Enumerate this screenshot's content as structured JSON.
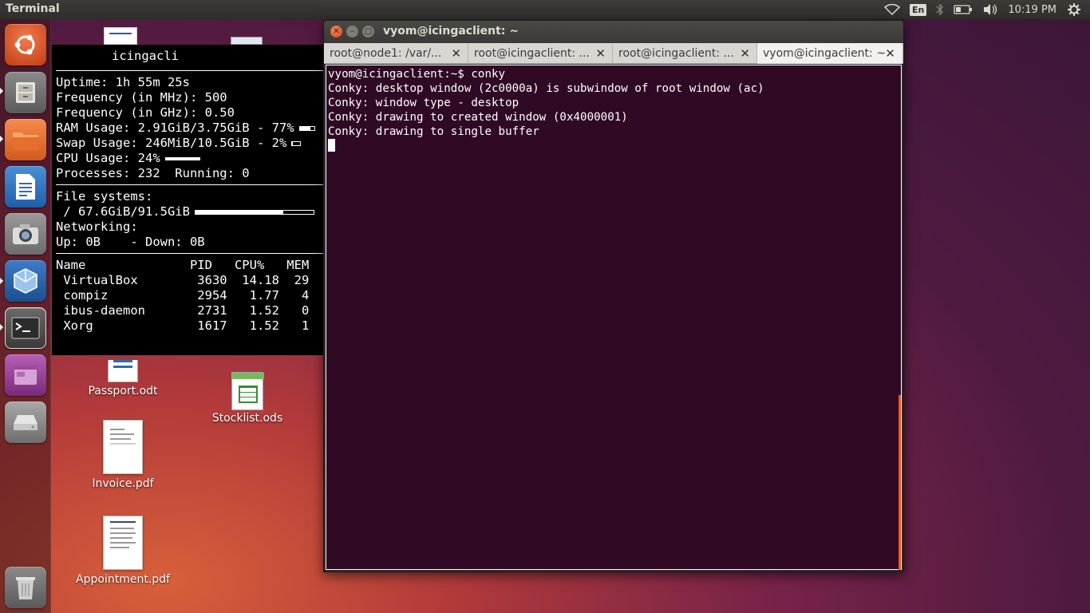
{
  "top_panel": {
    "app_title": "Terminal",
    "keyboard_layout": "En",
    "clock": "10:19 PM"
  },
  "launcher": {
    "items": [
      {
        "name": "Dash"
      },
      {
        "name": "Files"
      },
      {
        "name": "Files Folder"
      },
      {
        "name": "LibreOffice Writer"
      },
      {
        "name": "Shotwell"
      },
      {
        "name": "VirtualBox"
      },
      {
        "name": "Terminal"
      },
      {
        "name": "Workspace Switcher"
      },
      {
        "name": "Disk"
      },
      {
        "name": "Trash"
      }
    ]
  },
  "desktop": {
    "icons": [
      {
        "label": "Passport.odt"
      },
      {
        "label": "Stocklist.ods"
      },
      {
        "label": "Invoice.pdf"
      },
      {
        "label": "Appointment.pdf"
      }
    ]
  },
  "conky": {
    "hostname": "icingacli",
    "uptime": "Uptime: 1h 55m 25s",
    "freq_mhz": "Frequency (in MHz): 500",
    "freq_ghz": "Frequency (in GHz): 0.50",
    "ram": "RAM Usage: 2.91GiB/3.75GiB - 77%",
    "ram_fraction": 0.77,
    "swap": "Swap Usage: 246MiB/10.5GiB - 2%",
    "swap_fraction": 0.02,
    "cpu": "CPU Usage: 24%",
    "cpu_fraction": 0.24,
    "processes": "Processes: 232  Running: 0",
    "fs_header": "File systems:",
    "fs_root": " / 67.6GiB/91.5GiB",
    "fs_fraction": 0.74,
    "net_header": "Networking:",
    "net_line": "Up: 0B    - Down: 0B",
    "proc_header": "Name              PID   CPU%   MEM",
    "procs": [
      " VirtualBox        3630  14.18  29",
      " compiz            2954   1.77   4",
      " ibus-daemon       2731   1.52   0",
      " Xorg              1617   1.52   1"
    ]
  },
  "terminal": {
    "title": "vyom@icingaclient: ~",
    "tabs": [
      {
        "label": "root@node1: /var/..."
      },
      {
        "label": "root@icingaclient: ..."
      },
      {
        "label": "root@icingaclient: ..."
      },
      {
        "label": "vyom@icingaclient: ~"
      }
    ],
    "lines": [
      "vyom@icingaclient:~$ conky",
      "Conky: desktop window (2c0000a) is subwindow of root window (ac)",
      "Conky: window type - desktop",
      "Conky: drawing to created window (0x4000001)",
      "Conky: drawing to single buffer"
    ]
  },
  "colors": {
    "terminal_bg": "#300a24",
    "accent": "#e95420",
    "panel": "#3c3b37"
  }
}
